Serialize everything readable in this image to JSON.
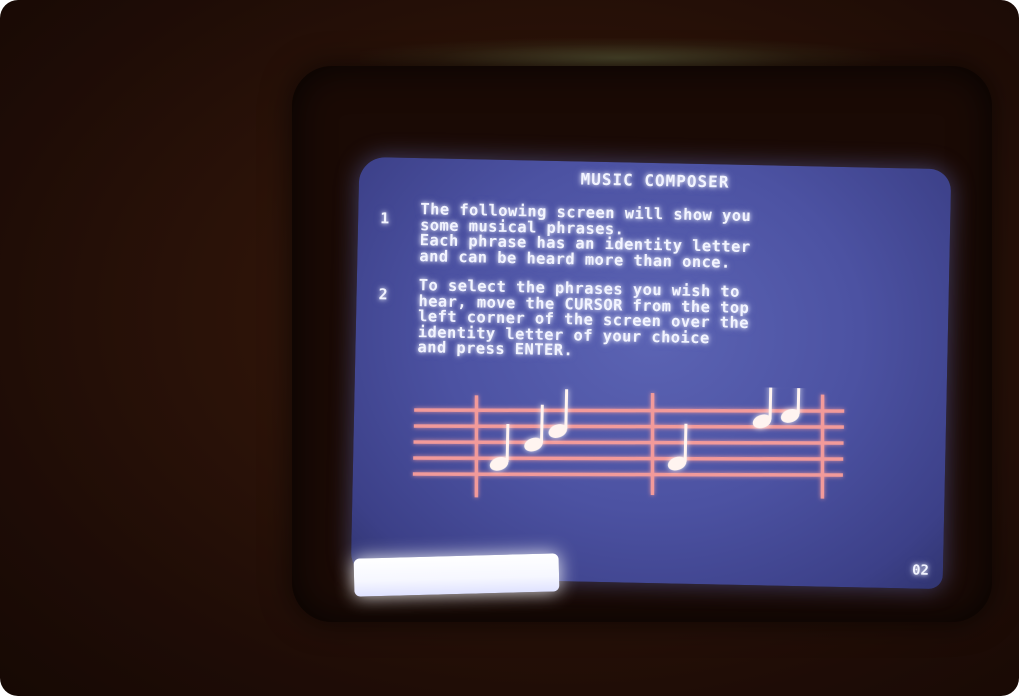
{
  "screen": {
    "title": "MUSIC COMPOSER",
    "instructions": [
      {
        "number": "1",
        "lines": [
          "The following screen will show you",
          "some musical phrases.",
          "Each phrase has an identity letter",
          "and can be heard more than once."
        ]
      },
      {
        "number": "2",
        "lines": [
          "To select the phrases you wish to",
          "hear, move the CURSOR from the top",
          "left corner of the screen over the",
          "identity letter of your choice",
          "and press ENTER."
        ]
      }
    ],
    "page_number": "02"
  },
  "colors": {
    "screen_background": "#4c52a2",
    "screen_text": "#f2f4ff",
    "staff_lines": "#f29a9a",
    "notes": "#fff4f0"
  },
  "icons": {
    "staff": "music-staff-icon",
    "notes": "music-note-icon"
  }
}
